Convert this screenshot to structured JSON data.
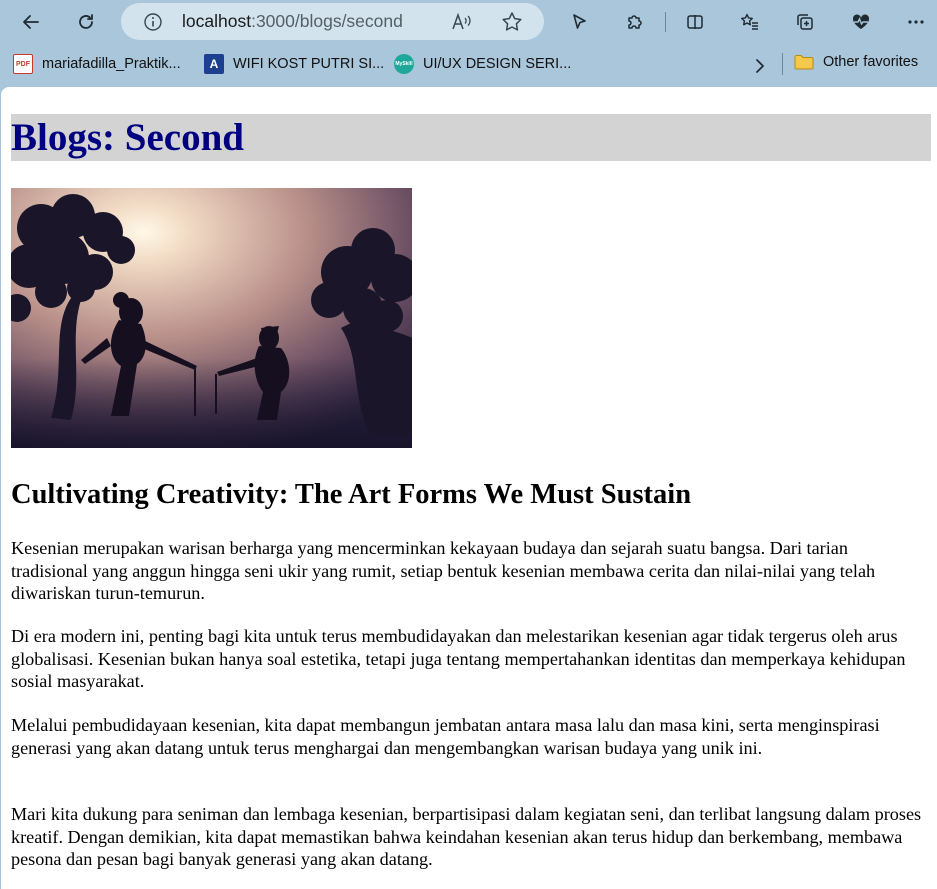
{
  "browser": {
    "address_host": "localhost",
    "address_path": ":3000/blogs/second",
    "icons": [
      "back-arrow-icon",
      "refresh-icon",
      "info-icon",
      "read-aloud-icon",
      "favorite-star-icon",
      "cursor-icon",
      "extensions-icon",
      "split-screen-icon",
      "favorites-list-icon",
      "collections-icon",
      "health-icon",
      "more-icon"
    ]
  },
  "favorites": {
    "items": [
      {
        "label": "mariafadilla_Praktik...",
        "icon": "pdf-icon"
      },
      {
        "label": "WIFI KOST PUTRI SI...",
        "icon": "a-logo-icon"
      },
      {
        "label": "UI/UX DESIGN SERI...",
        "icon": "myskill-icon"
      }
    ],
    "pdf_badge": "PDF",
    "a_badge": "A",
    "my_badge": "MySkill",
    "other_label": "Other favorites"
  },
  "page": {
    "header_title": "Blogs: Second",
    "article_title": "Cultivating Creativity: The Art Forms We Must Sustain",
    "paragraphs": [
      "Kesenian merupakan warisan berharga yang mencerminkan kekayaan budaya dan sejarah suatu bangsa. Dari tarian tradisional yang anggun hingga seni ukir yang rumit, setiap bentuk kesenian membawa cerita dan nilai-nilai yang telah diwariskan turun-temurun.",
      "Di era modern ini, penting bagi kita untuk terus membudidayakan dan melestarikan kesenian agar tidak tergerus oleh arus globalisasi. Kesenian bukan hanya soal estetika, tetapi juga tentang mempertahankan identitas dan memperkaya kehidupan sosial masyarakat.",
      "Melalui pembudidayaan kesenian, kita dapat membangun jembatan antara masa lalu dan masa kini, serta menginspirasi generasi yang akan datang untuk terus menghargai dan mengembangkan warisan budaya yang unik ini.",
      "Mari kita dukung para seniman dan lembaga kesenian, berpartisipasi dalam kegiatan seni, dan terlibat langsung dalam proses kreatif. Dengan demikian, kita dapat memastikan bahwa keindahan kesenian akan terus hidup dan berkembang, membawa pesona dan pesan bagi banyak generasi yang akan datang."
    ]
  },
  "colors": {
    "browser_chrome": "#a9c6db",
    "address_bar": "#d2e3ee",
    "header_bg": "#d3d3d3",
    "header_text": "#000080"
  }
}
